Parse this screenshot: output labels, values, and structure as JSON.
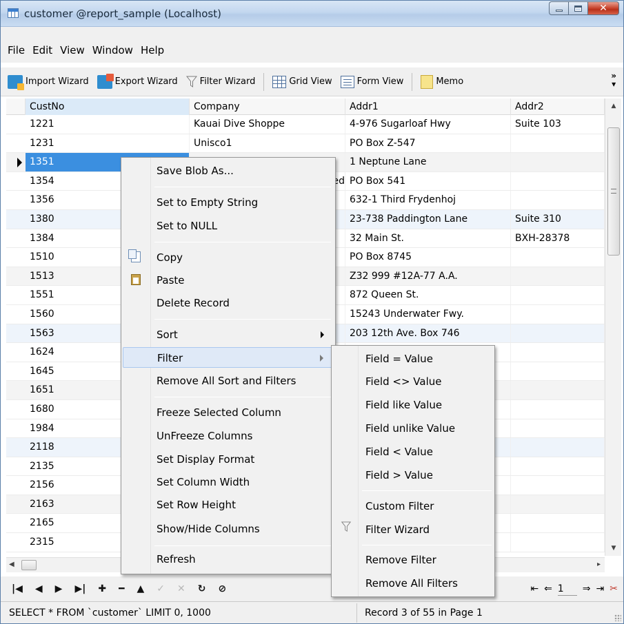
{
  "window": {
    "title": "customer @report_sample (Localhost)"
  },
  "menu": [
    "File",
    "Edit",
    "View",
    "Window",
    "Help"
  ],
  "toolbar": {
    "import_wizard": "Import Wizard",
    "export_wizard": "Export Wizard",
    "filter_wizard": "Filter Wizard",
    "grid_view": "Grid View",
    "form_view": "Form View",
    "memo": "Memo",
    "overflow": "»"
  },
  "grid": {
    "columns": [
      "CustNo",
      "Company",
      "Addr1",
      "Addr2"
    ],
    "rows": [
      [
        "1221",
        "Kauai Dive Shoppe",
        "4-976 Sugarloaf Hwy",
        "Suite 103"
      ],
      [
        "1231",
        "Unisco1",
        "PO Box Z-547",
        ""
      ],
      [
        "1351",
        "",
        "1 Neptune Lane",
        ""
      ],
      [
        "1354",
        "ed",
        "PO Box 541",
        ""
      ],
      [
        "1356",
        "",
        "632-1 Third Frydenhoj",
        ""
      ],
      [
        "1380",
        "",
        "23-738 Paddington Lane",
        "Suite 310"
      ],
      [
        "1384",
        "",
        "32 Main St.",
        "BXH-28378"
      ],
      [
        "1510",
        "",
        "PO Box 8745",
        ""
      ],
      [
        "1513",
        "",
        "Z32 999 #12A-77 A.A.",
        ""
      ],
      [
        "1551",
        "",
        "872 Queen St.",
        ""
      ],
      [
        "1560",
        "",
        "15243 Underwater Fwy.",
        ""
      ],
      [
        "1563",
        "",
        "203 12th Ave. Box 746",
        ""
      ],
      [
        "1624",
        "",
        "",
        ""
      ],
      [
        "1645",
        "",
        "",
        ""
      ],
      [
        "1651",
        "",
        "",
        ""
      ],
      [
        "1680",
        "",
        "",
        ""
      ],
      [
        "1984",
        "",
        "",
        ""
      ],
      [
        "2118",
        "",
        "",
        ""
      ],
      [
        "2135",
        "",
        "",
        ""
      ],
      [
        "2156",
        "",
        "",
        ""
      ],
      [
        "2163",
        "",
        "",
        ""
      ],
      [
        "2165",
        "",
        "",
        ""
      ],
      [
        "2315",
        "",
        "",
        ""
      ]
    ]
  },
  "context_menu": {
    "save_blob": "Save Blob As...",
    "set_empty": "Set to Empty String",
    "set_null": "Set to NULL",
    "copy": "Copy",
    "paste": "Paste",
    "delete_record": "Delete Record",
    "sort": "Sort",
    "filter": "Filter",
    "remove_sort_filters": "Remove All Sort and Filters",
    "freeze_column": "Freeze Selected Column",
    "unfreeze": "UnFreeze Columns",
    "display_format": "Set Display Format",
    "column_width": "Set Column Width",
    "row_height": "Set Row Height",
    "show_hide": "Show/Hide Columns",
    "refresh": "Refresh"
  },
  "filter_submenu": {
    "eq": "Field = Value",
    "neq": "Field <> Value",
    "like": "Field like Value",
    "unlike": "Field unlike Value",
    "lt": "Field < Value",
    "gt": "Field > Value",
    "custom": "Custom Filter",
    "wizard": "Filter Wizard",
    "remove": "Remove Filter",
    "remove_all": "Remove All Filters"
  },
  "navigation": {
    "page": "1"
  },
  "status": {
    "sql": "SELECT * FROM `customer` LIMIT 0, 1000",
    "record": "Record 3 of 55 in Page 1"
  }
}
